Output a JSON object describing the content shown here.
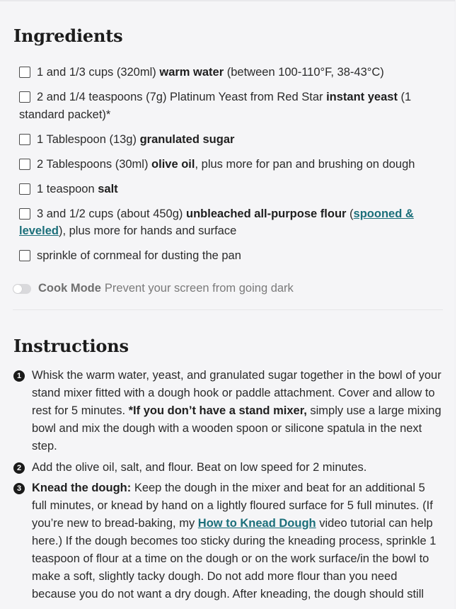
{
  "ingredients": {
    "heading": "Ingredients",
    "items": [
      {
        "pre": "1 and 1/3 cups (320ml) ",
        "bold": "warm water",
        "post": " (between 100-110°F, 38-43°C)"
      },
      {
        "pre": "2 and 1/4 teaspoons (7g) Platinum Yeast from Red Star ",
        "bold": "instant yeast",
        "post": " (1 standard packet)*"
      },
      {
        "pre": "1 Tablespoon (13g) ",
        "bold": "granulated sugar",
        "post": ""
      },
      {
        "pre": "2 Tablespoons (30ml) ",
        "bold": "olive oil",
        "post": ", plus more for pan and brushing on dough"
      },
      {
        "pre": "1 teaspoon ",
        "bold": "salt",
        "post": ""
      },
      {
        "pre": "3 and 1/2 cups (about 450g) ",
        "bold": "unbleached all-purpose flour",
        "post_a": " (",
        "link": "spooned & leveled",
        "post_b": "), plus more for hands and surface"
      },
      {
        "pre": "sprinkle of cornmeal for dusting the pan"
      }
    ]
  },
  "cook_mode": {
    "label": "Cook Mode",
    "description": "Prevent your screen from going dark",
    "enabled": false
  },
  "instructions": {
    "heading": "Instructions",
    "steps": [
      {
        "number": "1",
        "text_a": "Whisk the warm water, yeast, and granulated sugar together in the bowl of your stand mixer fitted with a dough hook or paddle attachment. Cover and allow to rest for 5 minutes. ",
        "bold": "*If you don’t have a stand mixer,",
        "text_b": " simply use a large mixing bowl and mix the dough with a wooden spoon or silicone spatula in the next step."
      },
      {
        "number": "2",
        "text_a": "Add the olive oil, salt, and flour. Beat on low speed for 2 minutes."
      },
      {
        "number": "3",
        "bold": "Knead the dough:",
        "text_a": " Keep the dough in the mixer and beat for an additional 5 full minutes, or knead by hand on a lightly floured surface for 5 full minutes. (If you’re new to bread-baking, my ",
        "link": "How to Knead Dough",
        "text_b": " video tutorial can help here.) If the dough becomes too sticky during the kneading process, sprinkle 1 teaspoon of flour at a time on the dough or on the work surface/in the bowl to make a soft, slightly tacky dough. Do not add more flour than you need because you do not want a dry dough. After kneading, the dough should still"
      }
    ]
  },
  "colors": {
    "background": "#f5f5f7",
    "link": "#1b6f7a",
    "text": "#2b2b2b"
  }
}
